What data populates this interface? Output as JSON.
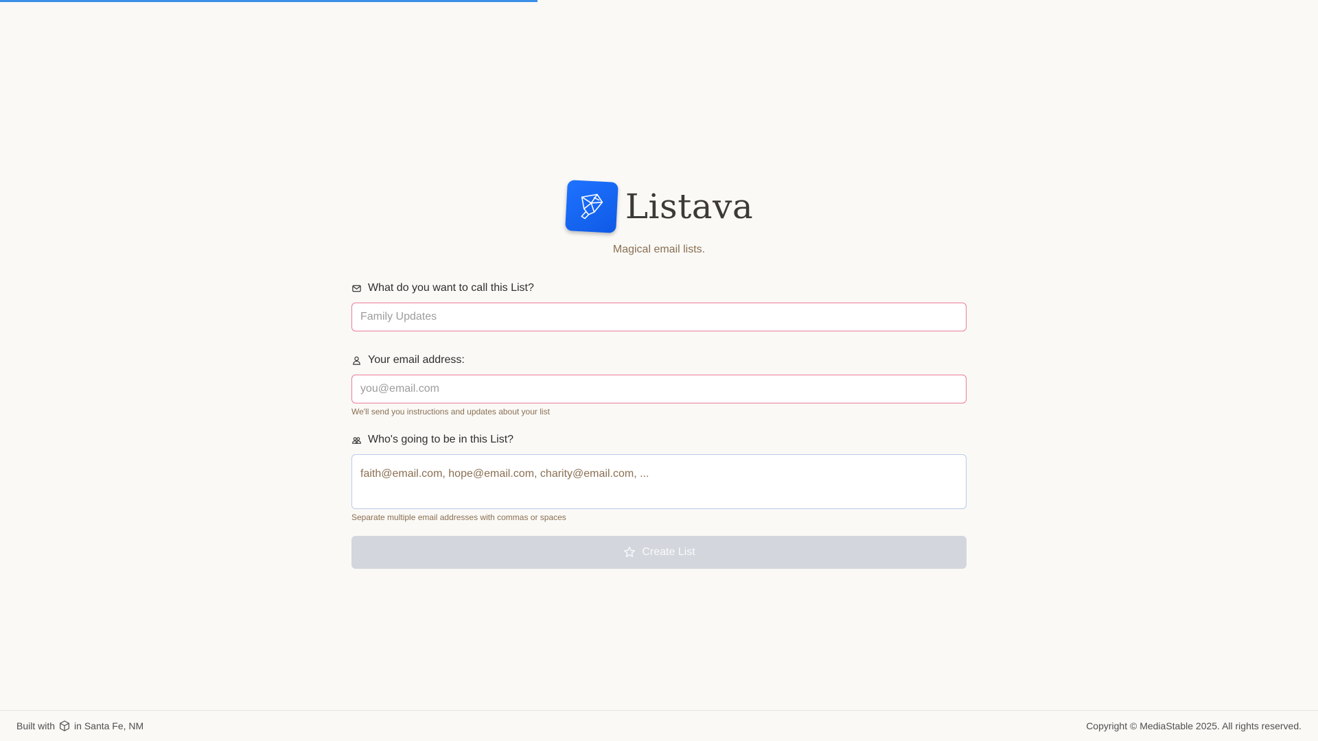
{
  "progress": {
    "fraction": 0.408,
    "color": "#3a8ee6"
  },
  "brand": {
    "name": "Listava",
    "tagline": "Magical email lists.",
    "logo_icon": "bird-origami-icon",
    "logo_color": "#1e73ff"
  },
  "form": {
    "list_name": {
      "label": "What do you want to call this List?",
      "icon": "mail-icon",
      "placeholder": "Family Updates"
    },
    "email": {
      "label": "Your email address:",
      "icon": "user-icon",
      "placeholder": "you@email.com",
      "hint": "We'll send you instructions and updates about your list"
    },
    "members": {
      "label": "Who's going to be in this List?",
      "icon": "users-icon",
      "placeholder": "faith@email.com, hope@email.com, charity@email.com, ...",
      "hint": "Separate multiple email addresses with commas or spaces"
    },
    "submit": {
      "label": "Create List",
      "icon": "star-icon",
      "disabled": true
    }
  },
  "footer": {
    "built_prefix": "Built with",
    "built_icon": "cube-icon",
    "built_suffix": "in Santa Fe, NM",
    "copyright": "Copyright © MediaStable 2025. All rights reserved."
  }
}
